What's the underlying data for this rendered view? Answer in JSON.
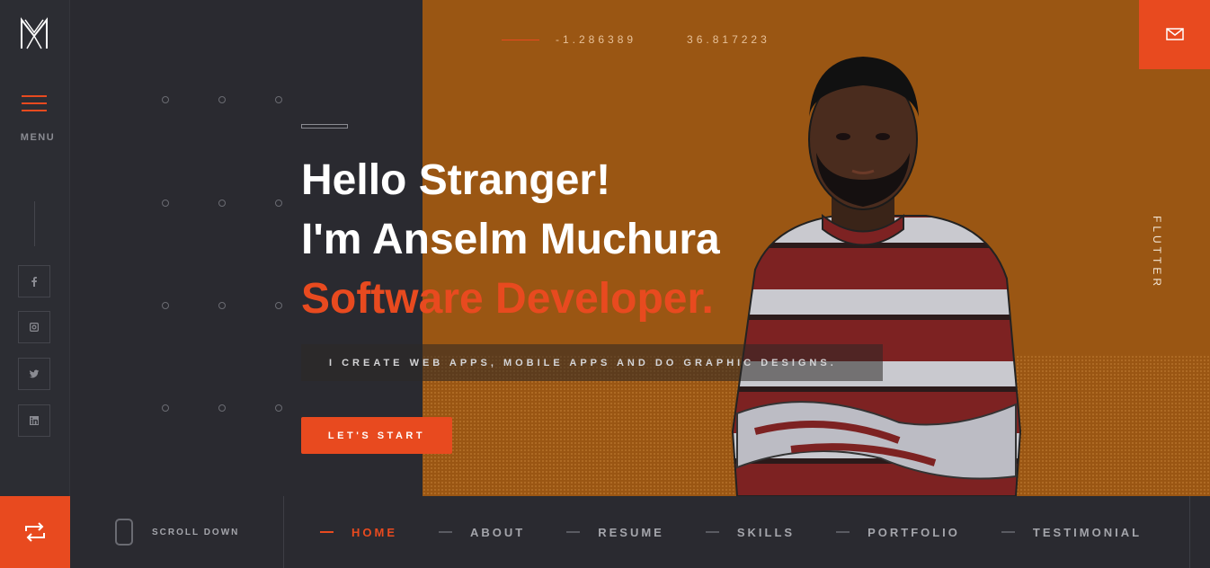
{
  "brand": {
    "logo_icon": "am-monogram-icon"
  },
  "sidebar": {
    "menu_label": "MENU",
    "socials": [
      {
        "icon": "facebook-icon"
      },
      {
        "icon": "instagram-icon"
      },
      {
        "icon": "twitter-icon"
      },
      {
        "icon": "linkedin-icon"
      }
    ]
  },
  "coords": {
    "lat": "-1.286389",
    "lon": "36.817223"
  },
  "hero": {
    "line1": "Hello Stranger!",
    "line2": "I'm Anselm Muchura",
    "line3": "Software Developer.",
    "subtitle": "I CREATE WEB APPS, MOBILE APPS AND DO GRAPHIC DESIGNS.",
    "cta": "LET'S START",
    "side_text": "FLUTTER"
  },
  "bottom": {
    "scroll_label": "SCROLL DOWN",
    "nav": [
      {
        "label": "HOME",
        "active": true
      },
      {
        "label": "ABOUT"
      },
      {
        "label": "RESUME"
      },
      {
        "label": "SKILLS"
      },
      {
        "label": "PORTFOLIO"
      },
      {
        "label": "TESTIMONIAL"
      }
    ]
  },
  "colors": {
    "accent": "#e84a1f",
    "hero_bg": "#9a5613",
    "dark": "#2a2a30"
  }
}
